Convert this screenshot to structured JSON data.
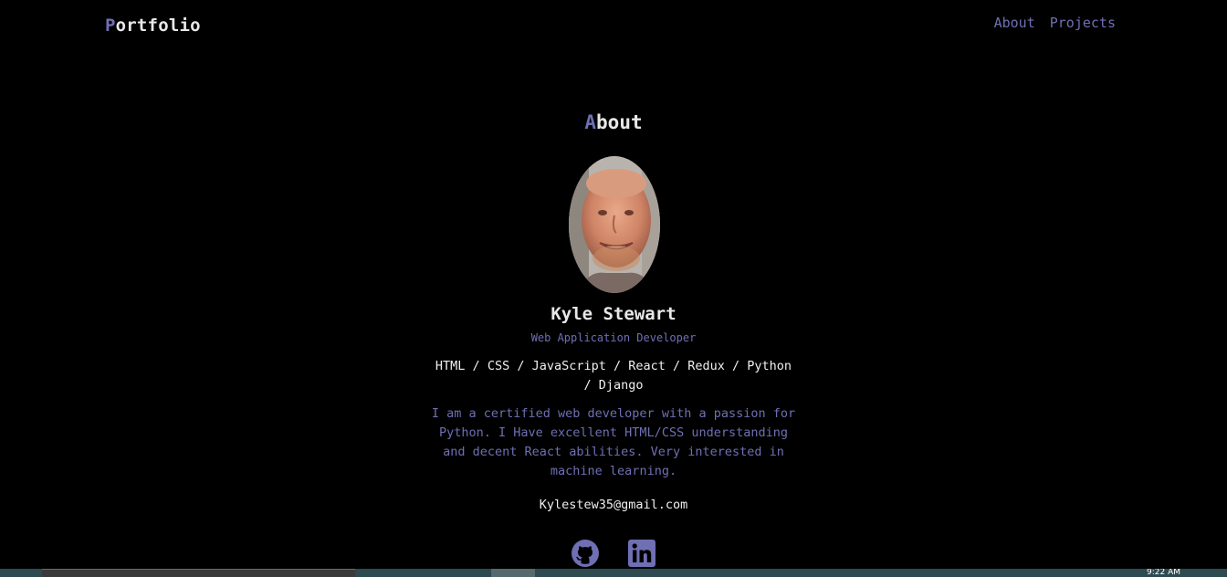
{
  "header": {
    "brand_initial": "P",
    "brand_rest": "ortfolio",
    "nav": [
      {
        "label": "About"
      },
      {
        "label": "Projects"
      }
    ]
  },
  "about": {
    "title_initial": "A",
    "title_rest": "bout",
    "avatar_alt": "profile photo",
    "name": "Kyle Stewart",
    "role": "Web Application Developer",
    "skills": "HTML / CSS / JavaScript / React / Redux / Python / Django",
    "bio": "I am a certified web developer with a passion for Python. I Have excellent HTML/CSS understanding and decent React abilities. Very interested in machine learning.",
    "email": "Kylestew35@gmail.com"
  },
  "socials": [
    {
      "icon": "github-icon"
    },
    {
      "icon": "linkedin-icon"
    }
  ],
  "taskbar": {
    "clock": "9:22 AM"
  },
  "colors": {
    "background": "#000000",
    "accent": "#6f6fb4",
    "text": "#e8e8e8"
  }
}
